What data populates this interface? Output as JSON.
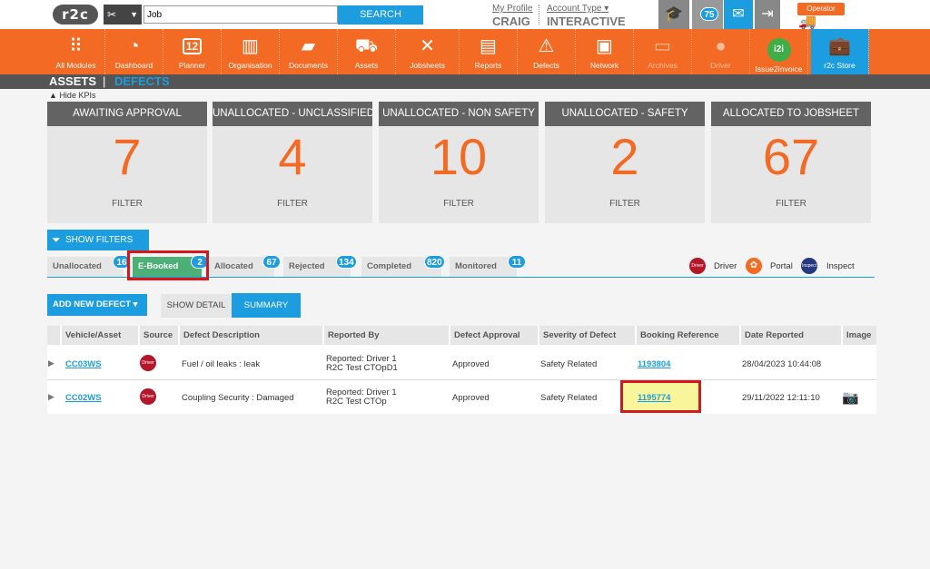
{
  "topbar": {
    "logo": "r2c",
    "search_value": "Job",
    "search_button": "SEARCH",
    "my_profile": "My Profile",
    "username": "CRAIG",
    "account_type_label": "Account Type",
    "account_type_value": "INTERACTIVE",
    "notifications_count": "75",
    "operator_label": "Operator"
  },
  "nav": [
    {
      "label": "All Modules",
      "icon": "grid-icon"
    },
    {
      "label": "Dashboard",
      "icon": "speedometer-icon"
    },
    {
      "label": "Planner",
      "icon": "calendar-icon",
      "badge": "12"
    },
    {
      "label": "Organisation",
      "icon": "buildings-icon"
    },
    {
      "label": "Documents",
      "icon": "folder-icon"
    },
    {
      "label": "Assets",
      "icon": "truck-icon"
    },
    {
      "label": "Jobsheets",
      "icon": "tools-icon"
    },
    {
      "label": "Reports",
      "icon": "clipboard-icon"
    },
    {
      "label": "Defects",
      "icon": "warning-icon"
    },
    {
      "label": "Network",
      "icon": "contacts-icon"
    },
    {
      "label": "Archives",
      "icon": "archive-icon"
    },
    {
      "label": "Driver",
      "icon": "driver-icon"
    },
    {
      "label": "Issue2Invoice",
      "icon": "i2i-icon",
      "logo_text": "i2i"
    },
    {
      "label": "r2c Store",
      "icon": "briefcase-icon"
    }
  ],
  "breadcrumb": {
    "assets": "ASSETS",
    "separator": "|",
    "defects": "DEFECTS"
  },
  "hide_kpis": "Hide KPIs",
  "kpis": [
    {
      "title": "AWAITING APPROVAL",
      "value": "7",
      "filter": "FILTER"
    },
    {
      "title": "UNALLOCATED - UNCLASSIFIED",
      "value": "4",
      "filter": "FILTER"
    },
    {
      "title": "UNALLOCATED - NON SAFETY",
      "value": "10",
      "filter": "FILTER"
    },
    {
      "title": "UNALLOCATED - SAFETY",
      "value": "2",
      "filter": "FILTER"
    },
    {
      "title": "ALLOCATED TO JOBSHEET",
      "value": "67",
      "filter": "FILTER"
    }
  ],
  "show_filters": "SHOW FILTERS",
  "tabs": [
    {
      "label": "Unallocated",
      "count": "16"
    },
    {
      "label": "E-Booked",
      "count": "2"
    },
    {
      "label": "Allocated",
      "count": "67"
    },
    {
      "label": "Rejected",
      "count": "134"
    },
    {
      "label": "Completed",
      "count": "820"
    },
    {
      "label": "Monitored",
      "count": "11"
    }
  ],
  "legend": [
    {
      "label": "Driver",
      "icon_text": "Driver",
      "color": "#b3172a"
    },
    {
      "label": "Portal",
      "icon_text": "",
      "color": "#f26a23"
    },
    {
      "label": "Inspect",
      "icon_text": "Inspect",
      "color": "#263a80"
    }
  ],
  "actions": {
    "add_defect": "ADD NEW DEFECT ▾",
    "show_detail": "SHOW DETAIL",
    "summary": "SUMMARY"
  },
  "table": {
    "headers": [
      "Vehicle/Asset",
      "Source",
      "Defect Description",
      "Reported By",
      "Defect Approval",
      "Severity of Defect",
      "Booking Reference",
      "Date Reported",
      "Image"
    ],
    "rows": [
      {
        "vehicle": "CC03WS",
        "source": "Driver",
        "description": "Fuel / oil leaks : leak",
        "reported_line1": "Reported: Driver 1",
        "reported_line2": "R2C Test CTOpD1",
        "approval": "Approved",
        "severity": "Safety Related",
        "booking": "1193804",
        "date": "28/04/2023 10:44:08"
      },
      {
        "vehicle": "CC02WS",
        "source": "Driver",
        "description": "Coupling Security : Damaged",
        "reported_line1": "Reported: Driver 1",
        "reported_line2": "R2C Test CTOp",
        "approval": "Approved",
        "severity": "Safety Related",
        "booking": "1195774",
        "date": "29/11/2022 12:11:10"
      }
    ]
  },
  "colors": {
    "brand_orange": "#f26a23",
    "accent_blue": "#1b9de0",
    "tab_active": "#4caf76",
    "highlight": "#d6171c"
  }
}
